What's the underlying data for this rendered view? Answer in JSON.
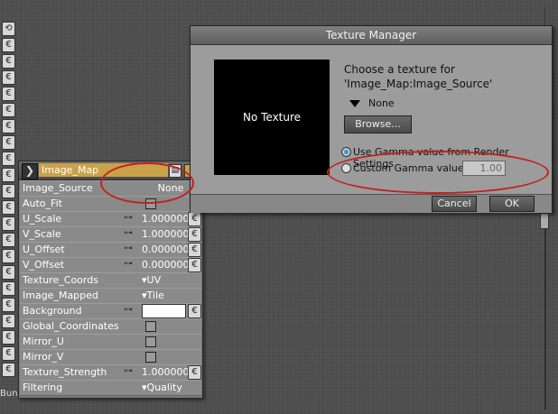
{
  "node": {
    "title": "Image_Map",
    "rows": [
      {
        "label": "Image_Source",
        "value": "None"
      },
      {
        "label": "Auto_Fit"
      },
      {
        "label": "U_Scale",
        "value": "1.000000"
      },
      {
        "label": "V_Scale",
        "value": "1.000000"
      },
      {
        "label": "U_Offset",
        "value": "0.000000"
      },
      {
        "label": "V_Offset",
        "value": "0.000000"
      },
      {
        "label": "Texture_Coords",
        "value": "UV"
      },
      {
        "label": "Image_Mapped",
        "value": "Tile"
      },
      {
        "label": "Background"
      },
      {
        "label": "Global_Coordinates"
      },
      {
        "label": "Mirror_U"
      },
      {
        "label": "Mirror_V"
      },
      {
        "label": "Texture_Strength",
        "value": "1.000000"
      },
      {
        "label": "Filtering",
        "value": "Quality"
      }
    ],
    "footer": "Bun"
  },
  "dialog": {
    "title": "Texture Manager",
    "preview_text": "No Texture",
    "prompt_line1": "Choose a texture for",
    "prompt_line2": "'Image_Map:Image_Source'",
    "selected_texture": "None",
    "browse_label": "Browse...",
    "radio_render_label": "Use Gamma value from Render Settings",
    "radio_custom_label": "Custom Gamma value:",
    "gamma_value": "1.00",
    "cancel_label": "Cancel",
    "ok_label": "OK"
  },
  "colors": {
    "node_title_bg": "#c9a24a",
    "annotation": "#c42020",
    "radio_selected": "#4a8fd0"
  }
}
